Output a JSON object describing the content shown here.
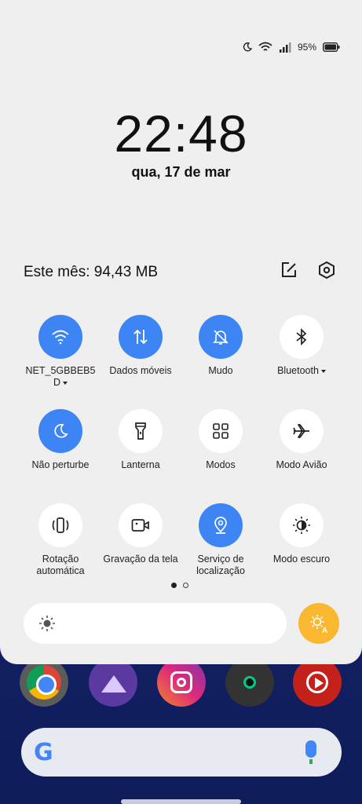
{
  "status_bar": {
    "battery_percent": "95%"
  },
  "clock": {
    "time": "22:48",
    "date": "qua, 17 de mar"
  },
  "usage": {
    "text": "Este mês: 94,43 MB"
  },
  "tiles": [
    {
      "label": "NET_5GBBEB5 D",
      "icon": "wifi-icon",
      "active": true,
      "dropdown": true
    },
    {
      "label": "Dados móveis",
      "icon": "mobile-data-icon",
      "active": true,
      "dropdown": false
    },
    {
      "label": "Mudo",
      "icon": "bell-off-icon",
      "active": true,
      "dropdown": false
    },
    {
      "label": "Bluetooth",
      "icon": "bluetooth-icon",
      "active": false,
      "dropdown": true
    },
    {
      "label": "Não perturbe",
      "icon": "moon-icon",
      "active": true,
      "dropdown": false
    },
    {
      "label": "Lanterna",
      "icon": "flashlight-icon",
      "active": false,
      "dropdown": false
    },
    {
      "label": "Modos",
      "icon": "grid-icon",
      "active": false,
      "dropdown": false
    },
    {
      "label": "Modo Avião",
      "icon": "airplane-icon",
      "active": false,
      "dropdown": false
    },
    {
      "label": "Rotação automática",
      "icon": "rotate-icon",
      "active": false,
      "dropdown": false
    },
    {
      "label": "Gravação da tela",
      "icon": "screen-record-icon",
      "active": false,
      "dropdown": false
    },
    {
      "label": "Serviço de localização",
      "icon": "location-icon",
      "active": true,
      "dropdown": false
    },
    {
      "label": "Modo escuro",
      "icon": "dark-mode-icon",
      "active": false,
      "dropdown": false
    }
  ],
  "pager": {
    "pages": 2,
    "current": 1
  },
  "colors": {
    "accent": "#3d84f5",
    "auto_brightness": "#f9b82f",
    "shade_bg": "#efefef"
  },
  "dock_apps": [
    "chrome-icon",
    "gallery-icon",
    "instagram-icon",
    "music-icon",
    "youtube-music-icon"
  ]
}
